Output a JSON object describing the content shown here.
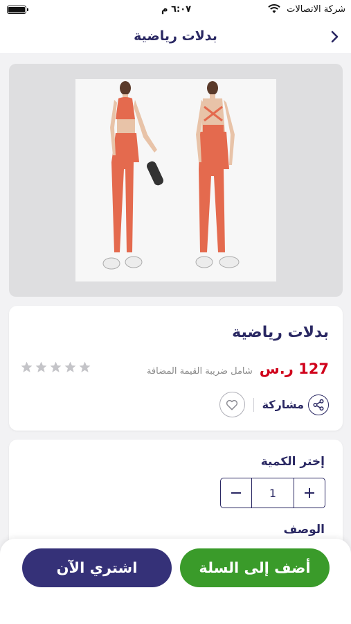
{
  "status_bar": {
    "time": "٦:٠٧ م",
    "carrier": "شركة الاتصالات"
  },
  "header": {
    "title": "بدلات رياضية",
    "back_icon": "chevron-right-icon"
  },
  "product": {
    "name": "بدلات رياضية",
    "price": "127 ر.س",
    "vat_note": "شامل ضريبة القيمة المضافة",
    "rating": 0,
    "rating_max": 5,
    "share_label": "مشاركة",
    "colors": {
      "accent": "#2a2863",
      "price": "#d0021b",
      "outfit": "#e46a4e"
    }
  },
  "quantity": {
    "title": "إختر الكمية",
    "value": "1"
  },
  "description": {
    "title": "الوصف"
  },
  "actions": {
    "add_to_cart": "أضف إلى السلة",
    "buy_now": "اشتري الآن",
    "add_color": "#3a9b2a",
    "buy_color": "#353178"
  }
}
